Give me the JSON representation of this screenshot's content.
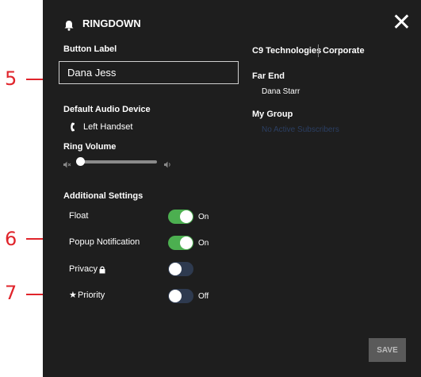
{
  "callouts": [
    "5",
    "6",
    "7"
  ],
  "header": {
    "title": "RINGDOWN"
  },
  "button_label": {
    "heading": "Button Label",
    "value": "Dana Jess"
  },
  "audio": {
    "heading": "Default Audio Device",
    "device": "Left Handset"
  },
  "ring_volume": {
    "heading": "Ring Volume",
    "level_percent": 0
  },
  "additional": {
    "heading": "Additional Settings",
    "settings": [
      {
        "label": "Float",
        "on": true,
        "state_label": "On"
      },
      {
        "label": "Popup Notification",
        "on": true,
        "state_label": "On"
      },
      {
        "label": "Privacy",
        "on": false,
        "state_label": ""
      },
      {
        "label": "Priority",
        "on": false,
        "state_label": "Off"
      }
    ]
  },
  "right": {
    "org": "C9 Technologies",
    "group_name": "Corporate",
    "far_end_heading": "Far End",
    "far_end_value": "Dana Starr",
    "my_group_heading": "My Group",
    "my_group_value": "No Active Subscribers"
  },
  "save_label": "SAVE",
  "colors": {
    "toggle_on": "#4caf50",
    "toggle_off": "#2e3a4f",
    "callout": "#e0242b",
    "muted_link": "#2b3f63"
  }
}
